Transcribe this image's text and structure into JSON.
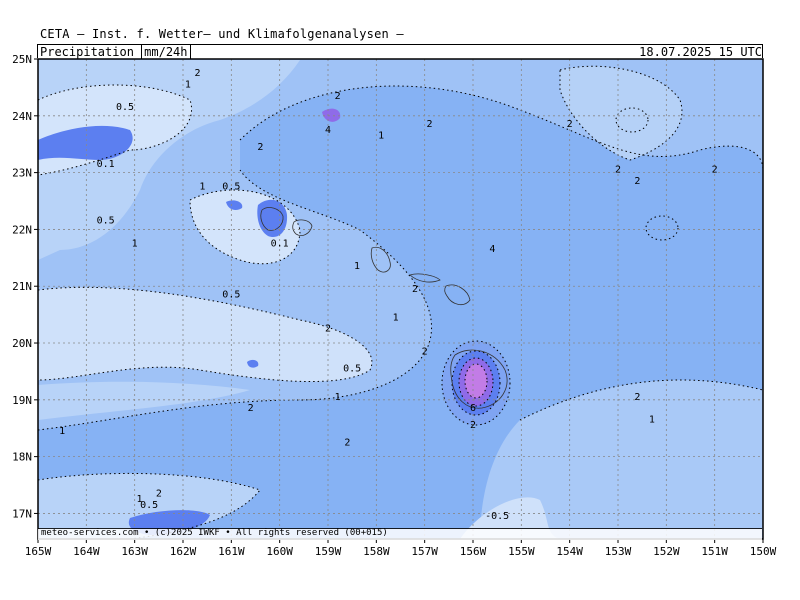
{
  "header": {
    "title": "CETA — Inst. f. Wetter— und Klimafolgenanalysen —",
    "variable": "Precipitation",
    "unit": "mm/24h",
    "valid_time": "18.07.2025 15 UTC"
  },
  "footer": {
    "credit": "meteo-services.com • (c)2025 IWKF • All rights reserved (00+015)"
  },
  "axes": {
    "lat_labels": [
      "25N",
      "24N",
      "23N",
      "22N",
      "21N",
      "20N",
      "19N",
      "18N",
      "17N"
    ],
    "lon_labels": [
      "165W",
      "164W",
      "163W",
      "162W",
      "161W",
      "160W",
      "159W",
      "158W",
      "157W",
      "156W",
      "155W",
      "154W",
      "153W",
      "152W",
      "151W",
      "150W"
    ]
  },
  "colors": {
    "bg_lightest": "#d6e6fb",
    "level_05": "#b6d2f7",
    "level_1": "#97bdf5",
    "level_2": "#7fadf3",
    "level_4": "#5c7ff0",
    "level_6": "#8f6be8",
    "level_8": "#c27ce6",
    "peak": "#d68be8"
  },
  "contour_labels": [
    {
      "text": "2",
      "lon": -161.7,
      "lat": 24.7
    },
    {
      "text": "1",
      "lon": -161.9,
      "lat": 24.5
    },
    {
      "text": "0.5",
      "lon": -163.2,
      "lat": 24.1
    },
    {
      "text": "2",
      "lon": -158.8,
      "lat": 24.3
    },
    {
      "text": "4",
      "lon": -159.0,
      "lat": 23.7
    },
    {
      "text": "2",
      "lon": -156.9,
      "lat": 23.8
    },
    {
      "text": "1",
      "lon": -157.9,
      "lat": 23.6
    },
    {
      "text": "2",
      "lon": -160.4,
      "lat": 23.4
    },
    {
      "text": "0.1",
      "lon": -163.6,
      "lat": 23.1
    },
    {
      "text": "1",
      "lon": -161.6,
      "lat": 22.7
    },
    {
      "text": "0.5",
      "lon": -161.0,
      "lat": 22.7
    },
    {
      "text": "0.5",
      "lon": -163.6,
      "lat": 22.1
    },
    {
      "text": "0.1",
      "lon": -160.0,
      "lat": 21.7
    },
    {
      "text": "1",
      "lon": -163.0,
      "lat": 21.7
    },
    {
      "text": "1",
      "lon": -158.4,
      "lat": 21.3
    },
    {
      "text": "4",
      "lon": -155.6,
      "lat": 21.6
    },
    {
      "text": "2",
      "lon": -157.2,
      "lat": 20.9
    },
    {
      "text": "0.5",
      "lon": -161.0,
      "lat": 20.8
    },
    {
      "text": "1",
      "lon": -157.6,
      "lat": 20.4
    },
    {
      "text": "2",
      "lon": -159.0,
      "lat": 20.2
    },
    {
      "text": "2",
      "lon": -157.0,
      "lat": 19.8
    },
    {
      "text": "0.5",
      "lon": -158.5,
      "lat": 19.5
    },
    {
      "text": "1",
      "lon": -158.8,
      "lat": 19.0
    },
    {
      "text": "2",
      "lon": -160.6,
      "lat": 18.8
    },
    {
      "text": "2",
      "lon": -158.6,
      "lat": 18.2
    },
    {
      "text": "6",
      "lon": -156.0,
      "lat": 18.8
    },
    {
      "text": "2",
      "lon": -156.0,
      "lat": 18.5
    },
    {
      "text": "2",
      "lon": -154.0,
      "lat": 23.8
    },
    {
      "text": "2",
      "lon": -153.0,
      "lat": 23.0
    },
    {
      "text": "2",
      "lon": -152.6,
      "lat": 22.8
    },
    {
      "text": "2",
      "lon": -151.0,
      "lat": 23.0
    },
    {
      "text": "2",
      "lon": -152.6,
      "lat": 19.0
    },
    {
      "text": "1",
      "lon": -152.3,
      "lat": 18.6
    },
    {
      "text": "1",
      "lon": -164.5,
      "lat": 18.4
    },
    {
      "text": "1",
      "lon": -162.9,
      "lat": 17.2
    },
    {
      "text": "2",
      "lon": -162.5,
      "lat": 17.3
    },
    {
      "text": "0.5",
      "lon": -162.7,
      "lat": 17.1
    },
    {
      "text": "-0.5",
      "lon": -155.5,
      "lat": 16.9
    }
  ]
}
